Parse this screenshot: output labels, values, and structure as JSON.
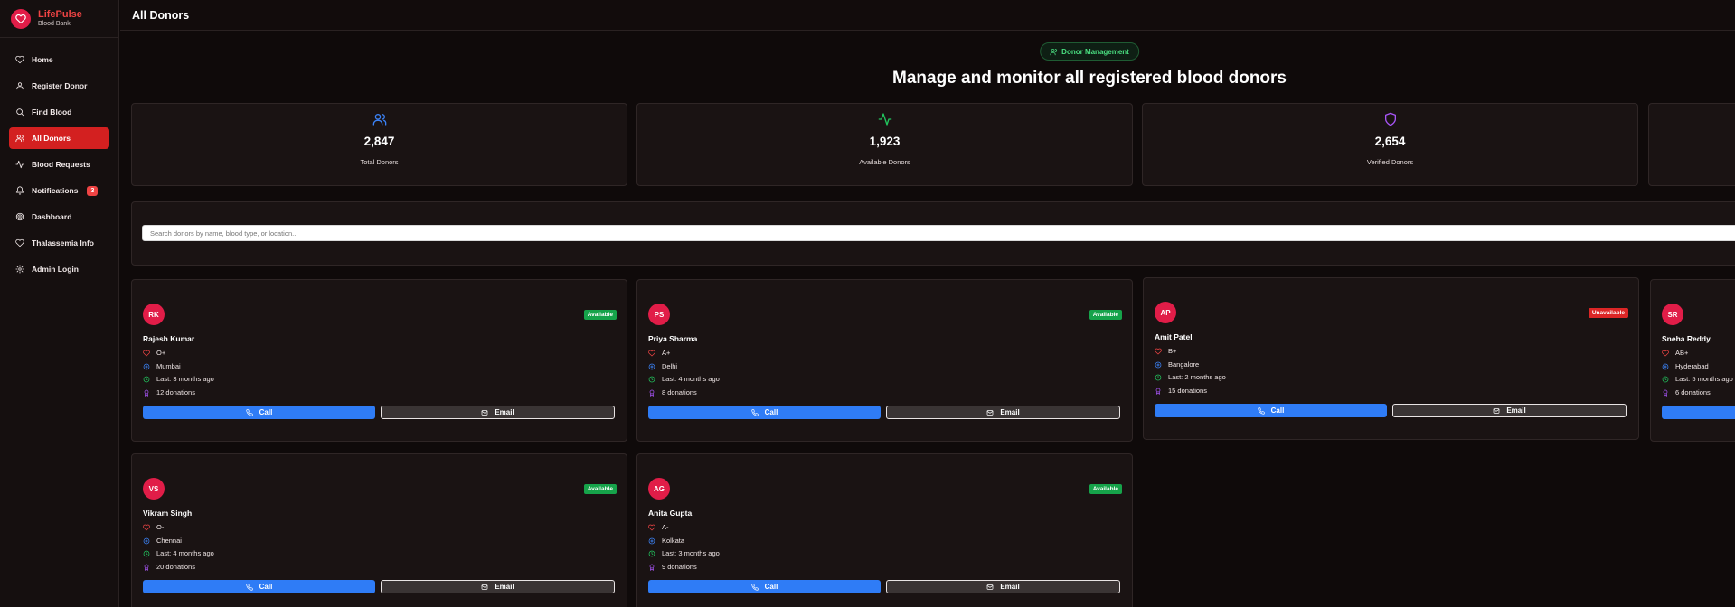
{
  "brand": {
    "name": "LifePulse",
    "subtitle": "Blood Bank"
  },
  "nav": [
    {
      "label": "Home",
      "icon": "heart-icon"
    },
    {
      "label": "Register Donor",
      "icon": "user-icon"
    },
    {
      "label": "Find Blood",
      "icon": "search-icon"
    },
    {
      "label": "All Donors",
      "icon": "users-icon",
      "active": true
    },
    {
      "label": "Blood Requests",
      "icon": "activity-icon"
    },
    {
      "label": "Notifications",
      "icon": "bell-icon",
      "badge": "3"
    },
    {
      "label": "Dashboard",
      "icon": "dashboard-icon"
    },
    {
      "label": "Thalassemia Info",
      "icon": "heart-icon"
    },
    {
      "label": "Admin Login",
      "icon": "gear-icon"
    }
  ],
  "header": {
    "title": "All Donors"
  },
  "hero": {
    "pill": "Donor Management",
    "title": "Manage and monitor all registered blood donors"
  },
  "stats": [
    {
      "value": "2,847",
      "label": "Total Donors",
      "icon": "users-icon",
      "color": "#3b82f6"
    },
    {
      "value": "1,923",
      "label": "Available Donors",
      "icon": "activity-icon",
      "color": "#22c55e"
    },
    {
      "value": "2,654",
      "label": "Verified Donors",
      "icon": "shield-icon",
      "color": "#a855f7"
    }
  ],
  "search": {
    "placeholder": "Search donors by name, blood type, or location..."
  },
  "donors": [
    {
      "initials": "RK",
      "name": "Rajesh Kumar",
      "blood": "O+",
      "city": "Mumbai",
      "last": "Last: 3 months ago",
      "donations": "12 donations",
      "status": "Available"
    },
    {
      "initials": "PS",
      "name": "Priya Sharma",
      "blood": "A+",
      "city": "Delhi",
      "last": "Last: 4 months ago",
      "donations": "8 donations",
      "status": "Available"
    },
    {
      "initials": "AP",
      "name": "Amit Patel",
      "blood": "B+",
      "city": "Bangalore",
      "last": "Last: 2 months ago",
      "donations": "15 donations",
      "status": "Unavailable"
    },
    {
      "initials": "SR",
      "name": "Sneha Reddy",
      "blood": "AB+",
      "city": "Hyderabad",
      "last": "Last: 5 months ago",
      "donations": "6 donations",
      "status": ""
    },
    {
      "initials": "VS",
      "name": "Vikram Singh",
      "blood": "O-",
      "city": "Chennai",
      "last": "Last: 4 months ago",
      "donations": "20 donations",
      "status": "Available"
    },
    {
      "initials": "AG",
      "name": "Anita Gupta",
      "blood": "A-",
      "city": "Kolkata",
      "last": "Last: 3 months ago",
      "donations": "9 donations",
      "status": "Available"
    }
  ],
  "actions": {
    "call": "Call",
    "email": "Email"
  },
  "colors": {
    "accent": "#d32020",
    "brand": "#e11d48",
    "call": "#2f7cf6",
    "available": "#16a34a",
    "unavailable": "#dc2626"
  }
}
